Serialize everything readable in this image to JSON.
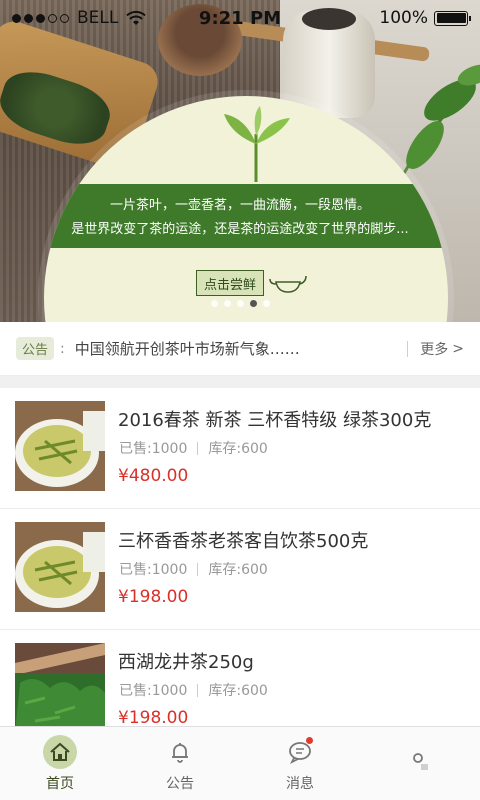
{
  "status_bar": {
    "carrier": "BELL",
    "time": "9:21 PM",
    "battery": "100%"
  },
  "banner": {
    "line1": "一片茶叶，一壶香茗，一曲流觞，一段恩情。",
    "line2": "是世界改变了茶的运途，还是茶的运途改变了世界的脚步...",
    "cta": "点击尝鲜",
    "page_count": 5,
    "active_page": 4
  },
  "notice": {
    "tag": "公告",
    "colon": ":",
    "text": "中国领航开创茶叶市场新气象……",
    "more": "更多",
    "more_arrow": ">"
  },
  "products": [
    {
      "name": "2016春茶 新茶 三杯香特级 绿茶300克",
      "sold": "已售:1000",
      "stock": "库存:600",
      "price": "¥480.00"
    },
    {
      "name": "三杯香香茶老茶客自饮茶500克",
      "sold": "已售:1000",
      "stock": "库存:600",
      "price": "¥198.00"
    },
    {
      "name": "西湖龙井茶250g",
      "sold": "已售:1000",
      "stock": "库存:600",
      "price": "¥198.00"
    }
  ],
  "tabs": [
    {
      "label": "首页",
      "icon": "home-icon"
    },
    {
      "label": "公告",
      "icon": "bell-icon"
    },
    {
      "label": "消息",
      "icon": "chat-icon"
    },
    {
      "label": "",
      "icon": "user-icon"
    }
  ],
  "colors": {
    "accent": "#3e7a2a",
    "price": "#d9312a",
    "tab_active_bg": "#c9d6a8"
  }
}
